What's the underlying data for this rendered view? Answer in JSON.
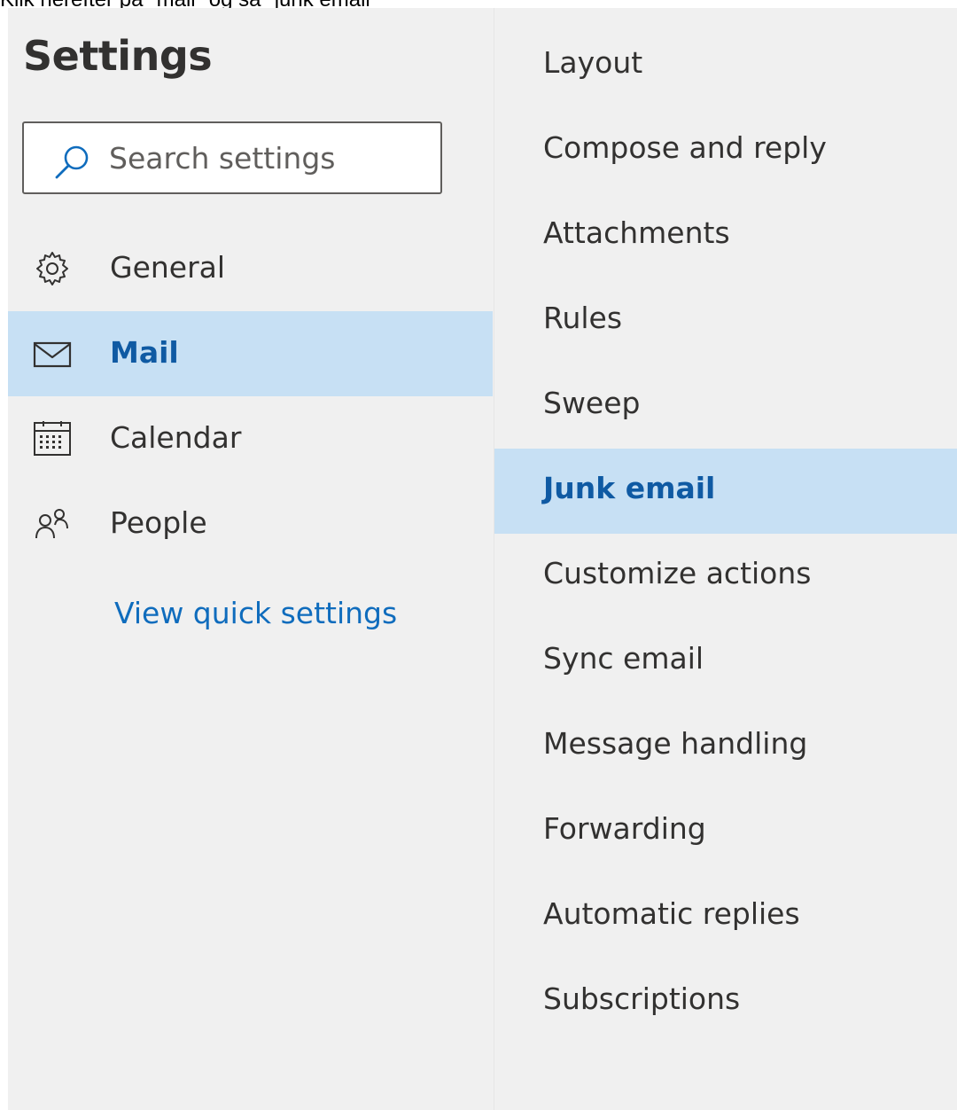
{
  "caption": "Klik herefter på \"mail\" og så \"junk email\"",
  "settings": {
    "title": "Settings",
    "search": {
      "placeholder": "Search settings",
      "icon": "search-icon"
    },
    "nav": [
      {
        "label": "General",
        "icon": "gear-icon",
        "selected": false
      },
      {
        "label": "Mail",
        "icon": "mail-icon",
        "selected": true
      },
      {
        "label": "Calendar",
        "icon": "calendar-icon",
        "selected": false
      },
      {
        "label": "People",
        "icon": "people-icon",
        "selected": false
      }
    ],
    "quick_settings_link": "View quick settings",
    "mail_subsections": [
      {
        "label": "Layout",
        "selected": false
      },
      {
        "label": "Compose and reply",
        "selected": false
      },
      {
        "label": "Attachments",
        "selected": false
      },
      {
        "label": "Rules",
        "selected": false
      },
      {
        "label": "Sweep",
        "selected": false
      },
      {
        "label": "Junk email",
        "selected": true
      },
      {
        "label": "Customize actions",
        "selected": false
      },
      {
        "label": "Sync email",
        "selected": false
      },
      {
        "label": "Message handling",
        "selected": false
      },
      {
        "label": "Forwarding",
        "selected": false
      },
      {
        "label": "Automatic replies",
        "selected": false
      },
      {
        "label": "Subscriptions",
        "selected": false
      }
    ]
  },
  "colors": {
    "background": "#f0f0f0",
    "selected_background": "#c7e0f4",
    "selected_text": "#0f5aa3",
    "link": "#0f6cbd",
    "text": "#323130"
  }
}
